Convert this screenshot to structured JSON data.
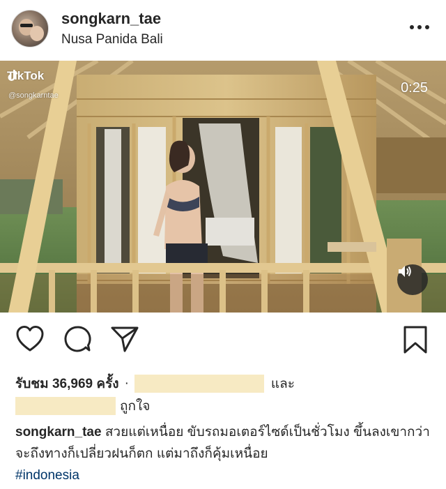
{
  "post": {
    "username": "songkarn_tae",
    "location": "Nusa Panida Bali"
  },
  "media": {
    "watermark_brand": "TikTok",
    "watermark_handle": "@songkarntae",
    "timer": "0:25"
  },
  "likes": {
    "views_label": "รับชม 36,969 ครั้ง",
    "separator": "·",
    "and_label": "และ",
    "liked_label": "ถูกใจ"
  },
  "caption": {
    "username": "songkarn_tae",
    "text": "สวยแต่เหนื่อย ขับรถมอเตอร์ไซด์เป็นชั่วโมง ขึ้นลงเขากว่าจะถึงทางก็เปลี่ยวฝนก็ตก แต่มาถึงก็คุ้มเหนื่อย",
    "hashtag": "#indonesia"
  },
  "icons": {
    "more": "more-options-icon",
    "like": "heart-icon",
    "comment": "comment-icon",
    "share": "send-icon",
    "save": "bookmark-icon",
    "sound": "speaker-icon",
    "tiktok": "tiktok-logo-icon"
  },
  "colors": {
    "text": "#262626",
    "hashtag": "#003569",
    "redaction": "#f7eac3"
  }
}
